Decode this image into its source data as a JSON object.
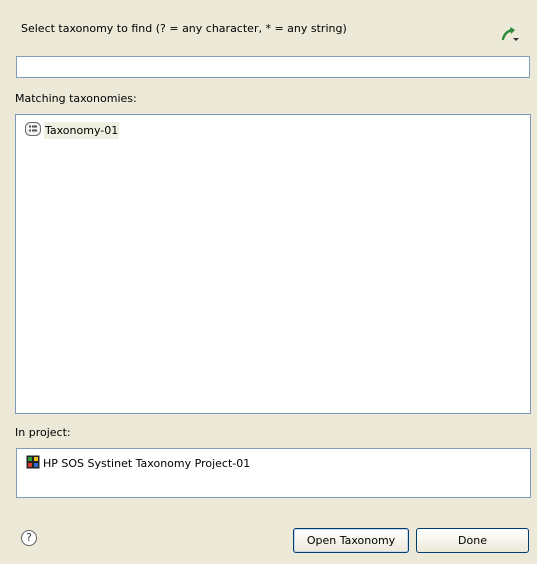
{
  "header": {
    "prompt": "Select taxonomy to find (? = any character, * = any string)"
  },
  "search": {
    "value": "",
    "placeholder": ""
  },
  "matching": {
    "label": "Matching taxonomies:",
    "items": [
      {
        "label": "Taxonomy-01",
        "icon": "taxonomy-icon",
        "selected": true
      }
    ]
  },
  "project": {
    "label": "In project:",
    "items": [
      {
        "label": "HP SOS Systinet Taxonomy Project-01",
        "icon": "project-icon"
      }
    ]
  },
  "buttons": {
    "open_label": "Open Taxonomy",
    "done_label": "Done"
  },
  "help": {
    "glyph": "?"
  },
  "colors": {
    "dialog_bg": "#ece9d8",
    "border": "#7f9db9",
    "selection_bg": "#eef0e2",
    "menu_arrow": "#2e8b3a"
  }
}
